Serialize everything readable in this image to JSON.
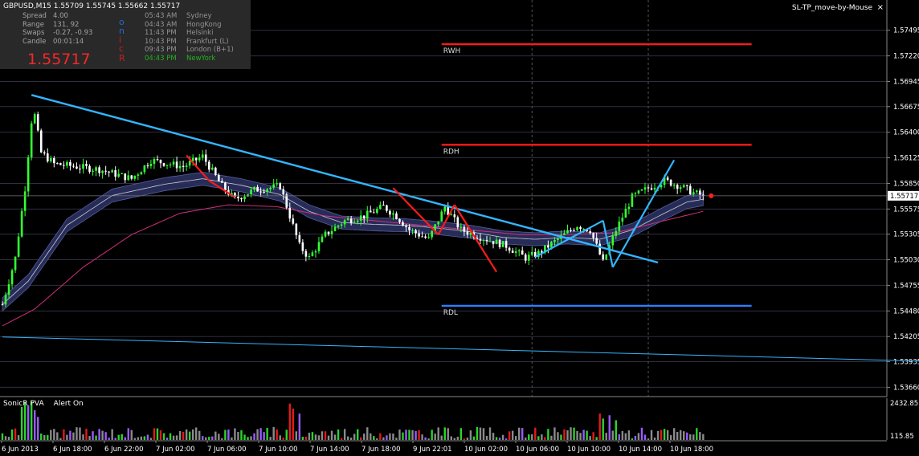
{
  "header": {
    "chart_title": "GBPUSD,M15  1.55709 1.55745 1.55662 1.55717",
    "ea_label": "SL-TP_move-by-Mouse",
    "close_glyph": "×"
  },
  "info_panel": {
    "stats": [
      {
        "label": "Spread",
        "value": "4.00"
      },
      {
        "label": "Range",
        "value": "131, 92"
      },
      {
        "label": "Swaps",
        "value": "-0.27, -0.93"
      },
      {
        "label": "Candle",
        "value": "00:01:14"
      }
    ],
    "big_price": "1.55717",
    "vertical_letters": [
      {
        "ch": "o",
        "color": "#2a6cd6"
      },
      {
        "ch": "n",
        "color": "#2a6cd6"
      },
      {
        "ch": "i",
        "color": "#cc2222"
      },
      {
        "ch": "c",
        "color": "#cc2222"
      },
      {
        "ch": "R",
        "color": "#cc2222"
      }
    ],
    "sessions": [
      {
        "time": "05:43 AM",
        "city": "Sydney",
        "color": "#999999"
      },
      {
        "time": "04:43 AM",
        "city": "HongKong",
        "color": "#999999"
      },
      {
        "time": "11:43 PM",
        "city": "Helsinki",
        "color": "#999999"
      },
      {
        "time": "10:43 PM",
        "city": "Frankfurt  (L)",
        "color": "#999999"
      },
      {
        "time": "09:43 PM",
        "city": "London  (B+1)",
        "color": "#999999"
      },
      {
        "time": "04:43 PM",
        "city": "NewYork",
        "color": "#22bb22"
      }
    ]
  },
  "subwindow": {
    "indicator": "SonicR PVA",
    "alert": "Alert On",
    "axis_top": "2432.85",
    "axis_bottom": "115.85"
  },
  "colors": {
    "background": "#000000",
    "bull_candle": "#33ff33",
    "bear_candle": "#ffffff",
    "red_line": "#ff1a1a",
    "blue_line": "#2a7fff",
    "trend_line": "#33b5ff",
    "grid": "#2f2f40",
    "ma_band": "#2a2f5c",
    "ma_slow": "#d0307a"
  },
  "chart_data": {
    "type": "candlestick",
    "symbol": "GBPUSD",
    "timeframe": "M15",
    "ohlc_current": {
      "open": 1.55709,
      "high": 1.55745,
      "low": 1.55662,
      "close": 1.55717
    },
    "current_price_label": "1.55717",
    "ylim": [
      1.5356,
      1.5782
    ],
    "y_ticks": [
      1.57495,
      1.5722,
      1.56945,
      1.56675,
      1.564,
      1.56125,
      1.5585,
      1.55575,
      1.55305,
      1.5503,
      1.54755,
      1.5448,
      1.54205,
      1.53935,
      1.5366
    ],
    "y_tick_labels": [
      "1.57495",
      "1.57220",
      "1.56945",
      "1.56675",
      "1.56400",
      "1.56125",
      "1.55850",
      "1.55575",
      "1.55305",
      "1.55030",
      "1.54755",
      "1.54480",
      "1.54205",
      "1.53935",
      "1.53660"
    ],
    "x_tick_labels": [
      "6 Jun 2013",
      "6 Jun 18:00",
      "6 Jun 22:00",
      "7 Jun 02:00",
      "7 Jun 06:00",
      "7 Jun 10:00",
      "7 Jun 14:00",
      "7 Jun 18:00",
      "9 Jun 22:01",
      "10 Jun 02:00",
      "10 Jun 06:00",
      "10 Jun 10:00",
      "10 Jun 14:00",
      "10 Jun 18:00"
    ],
    "bar_count": 218,
    "close_path": [
      [
        0,
        1.5455
      ],
      [
        4,
        1.5505
      ],
      [
        7,
        1.558
      ],
      [
        9,
        1.5652
      ],
      [
        10,
        1.5658
      ],
      [
        12,
        1.5618
      ],
      [
        16,
        1.5606
      ],
      [
        30,
        1.56
      ],
      [
        40,
        1.559
      ],
      [
        46,
        1.561
      ],
      [
        56,
        1.5603
      ],
      [
        62,
        1.5614
      ],
      [
        68,
        1.5582
      ],
      [
        72,
        1.5568
      ],
      [
        78,
        1.5578
      ],
      [
        86,
        1.5582
      ],
      [
        89,
        1.555
      ],
      [
        92,
        1.5518
      ],
      [
        95,
        1.5505
      ],
      [
        100,
        1.553
      ],
      [
        106,
        1.5545
      ],
      [
        112,
        1.555
      ],
      [
        118,
        1.556
      ],
      [
        122,
        1.555
      ],
      [
        126,
        1.5535
      ],
      [
        132,
        1.5525
      ],
      [
        137,
        1.556
      ],
      [
        142,
        1.5535
      ],
      [
        150,
        1.5525
      ],
      [
        156,
        1.5518
      ],
      [
        162,
        1.5505
      ],
      [
        166,
        1.551
      ],
      [
        172,
        1.5525
      ],
      [
        178,
        1.554
      ],
      [
        182,
        1.5535
      ],
      [
        186,
        1.55
      ],
      [
        190,
        1.5535
      ],
      [
        195,
        1.557
      ],
      [
        200,
        1.558
      ],
      [
        205,
        1.5588
      ],
      [
        210,
        1.5582
      ],
      [
        214,
        1.5575
      ],
      [
        217,
        1.55717
      ]
    ],
    "ma_fast_path": [
      [
        0,
        1.5455
      ],
      [
        8,
        1.548
      ],
      [
        20,
        1.554
      ],
      [
        34,
        1.5572
      ],
      [
        50,
        1.5584
      ],
      [
        62,
        1.559
      ],
      [
        74,
        1.5583
      ],
      [
        86,
        1.5573
      ],
      [
        95,
        1.5555
      ],
      [
        105,
        1.5543
      ],
      [
        115,
        1.5541
      ],
      [
        125,
        1.554
      ],
      [
        135,
        1.5537
      ],
      [
        145,
        1.5533
      ],
      [
        155,
        1.5527
      ],
      [
        165,
        1.5525
      ],
      [
        175,
        1.5527
      ],
      [
        185,
        1.5525
      ],
      [
        195,
        1.5535
      ],
      [
        205,
        1.5553
      ],
      [
        212,
        1.5565
      ],
      [
        217,
        1.5568
      ]
    ],
    "ma_slow_path": [
      [
        0,
        1.5432
      ],
      [
        10,
        1.545
      ],
      [
        25,
        1.5495
      ],
      [
        40,
        1.553
      ],
      [
        55,
        1.5553
      ],
      [
        70,
        1.5562
      ],
      [
        85,
        1.556
      ],
      [
        100,
        1.555
      ],
      [
        115,
        1.5545
      ],
      [
        130,
        1.554
      ],
      [
        145,
        1.5535
      ],
      [
        160,
        1.553
      ],
      [
        175,
        1.553
      ],
      [
        190,
        1.5532
      ],
      [
        205,
        1.5545
      ],
      [
        217,
        1.5555
      ]
    ],
    "levels": [
      {
        "label": "RWH",
        "price": 1.57345,
        "color": "#ff1a1a",
        "from_bar": 136,
        "to_bar": 232
      },
      {
        "label": "RDH",
        "price": 1.56265,
        "color": "#ff1a1a",
        "from_bar": 136,
        "to_bar": 232
      },
      {
        "label": "RDL",
        "price": 1.54535,
        "color": "#2a7fff",
        "from_bar": 136,
        "to_bar": 232
      }
    ],
    "trend_lines": [
      {
        "from": [
          9,
          1.568
        ],
        "to": [
          203,
          1.55
        ],
        "color": "#33b5ff",
        "width": 2.4
      },
      {
        "from": [
          0,
          1.542
        ],
        "to": [
          286,
          1.5394
        ],
        "color": "#33b5ff",
        "width": 1
      }
    ],
    "zigzag_red": [
      [
        [
          57,
          1.5615
        ],
        [
          64,
          1.5588
        ]
      ],
      [
        [
          64,
          1.5588
        ],
        [
          72,
          1.557
        ]
      ],
      [
        [
          121,
          1.558
        ],
        [
          135,
          1.553
        ]
      ],
      [
        [
          135,
          1.553
        ],
        [
          140,
          1.5562
        ]
      ],
      [
        [
          140,
          1.5562
        ],
        [
          153,
          1.549
        ]
      ]
    ],
    "zigzag_blue": [
      [
        [
          165,
          1.5506
        ],
        [
          186,
          1.5545
        ]
      ],
      [
        [
          186,
          1.5545
        ],
        [
          189,
          1.5495
        ]
      ],
      [
        [
          189,
          1.5495
        ],
        [
          208,
          1.561
        ]
      ]
    ],
    "volume": {
      "ylim": [
        115.85,
        2432.85
      ],
      "spikes": [
        {
          "bar": 6,
          "value": 2100,
          "color": "#2bd42b"
        },
        {
          "bar": 7,
          "value": 2400,
          "color": "#2bd42b"
        },
        {
          "bar": 8,
          "value": 2200,
          "color": "#9a5cff"
        },
        {
          "bar": 9,
          "value": 2430,
          "color": "#2bd42b"
        },
        {
          "bar": 10,
          "value": 1900,
          "color": "#9a5cff"
        },
        {
          "bar": 11,
          "value": 1500,
          "color": "#9a5cff"
        },
        {
          "bar": 89,
          "value": 2300,
          "color": "#e11b1b"
        },
        {
          "bar": 90,
          "value": 2000,
          "color": "#e11b1b"
        },
        {
          "bar": 92,
          "value": 1700,
          "color": "#9a5cff"
        },
        {
          "bar": 185,
          "value": 1700,
          "color": "#e11b1b"
        },
        {
          "bar": 186,
          "value": 1400,
          "color": "#2bd42b"
        },
        {
          "bar": 188,
          "value": 1600,
          "color": "#9a5cff"
        },
        {
          "bar": 190,
          "value": 1300,
          "color": "#2bd42b"
        }
      ]
    }
  }
}
